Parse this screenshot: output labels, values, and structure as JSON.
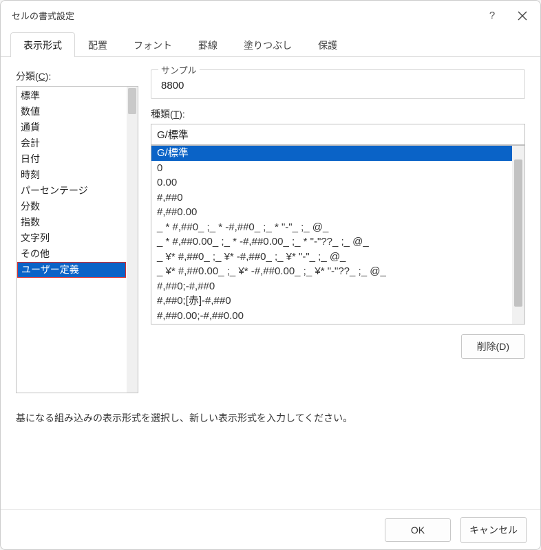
{
  "title": "セルの書式設定",
  "tabs": [
    "表示形式",
    "配置",
    "フォント",
    "罫線",
    "塗りつぶし",
    "保護"
  ],
  "activeTab": 0,
  "category": {
    "label_pre": "分類(",
    "label_u": "C",
    "label_post": "):",
    "items": [
      "標準",
      "数値",
      "通貨",
      "会計",
      "日付",
      "時刻",
      "パーセンテージ",
      "分数",
      "指数",
      "文字列",
      "その他",
      "ユーザー定義"
    ],
    "selectedIndex": 11
  },
  "sample": {
    "legend": "サンプル",
    "value": "8800"
  },
  "type": {
    "label_pre": "種類(",
    "label_u": "T",
    "label_post": "):",
    "value": "G/標準",
    "options": [
      "G/標準",
      "0",
      "0.00",
      "#,##0",
      "#,##0.00",
      "_ * #,##0_ ;_ * -#,##0_ ;_ * \"-\"_ ;_ @_",
      "_ * #,##0.00_ ;_ * -#,##0.00_ ;_ * \"-\"??_ ;_ @_",
      "_ ¥* #,##0_ ;_ ¥* -#,##0_ ;_ ¥* \"-\"_ ;_ @_",
      "_ ¥* #,##0.00_ ;_ ¥* -#,##0.00_ ;_ ¥* \"-\"??_ ;_ @_",
      "#,##0;-#,##0",
      "#,##0;[赤]-#,##0",
      "#,##0.00;-#,##0.00"
    ],
    "selectedIndex": 0
  },
  "deleteBtn": "削除(D)",
  "hint": "基になる組み込みの表示形式を選択し、新しい表示形式を入力してください。",
  "footer": {
    "ok": "OK",
    "cancel": "キャンセル"
  }
}
